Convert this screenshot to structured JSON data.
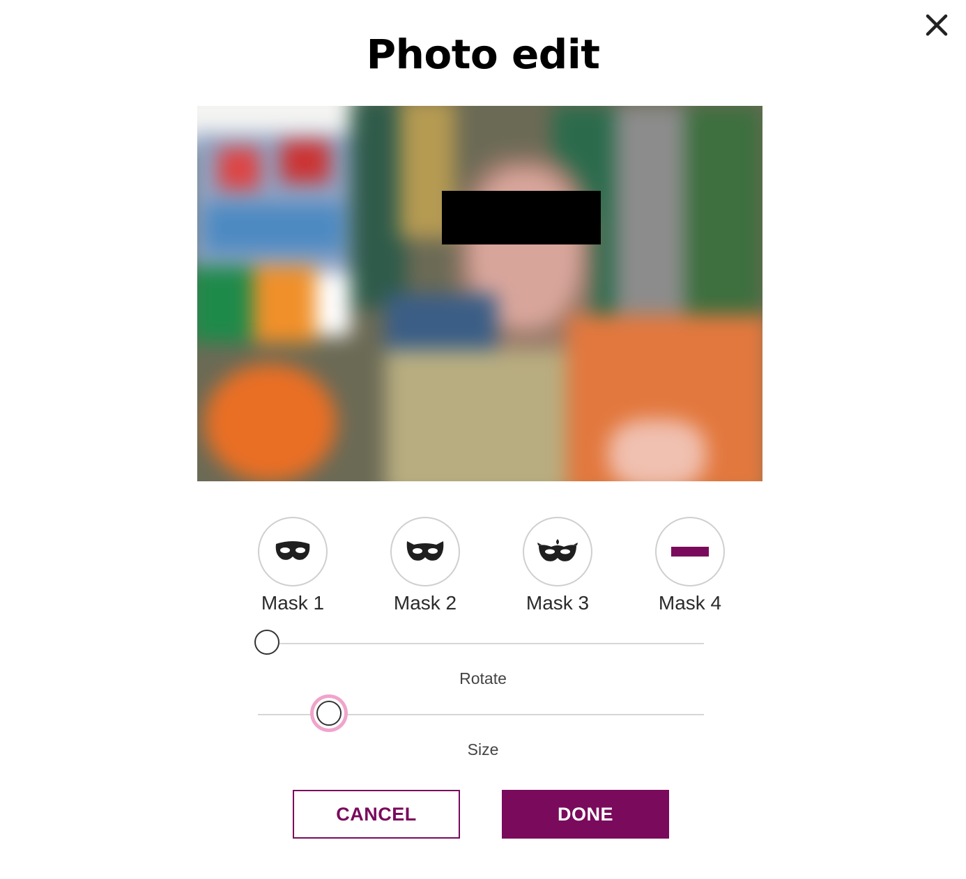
{
  "dialog": {
    "title": "Photo edit",
    "close_icon": "close-icon"
  },
  "photo": {
    "description_icon": "blurred-photo",
    "mask_color": "#000000"
  },
  "masks": [
    {
      "label": "Mask 1",
      "icon": "mask-plain-icon"
    },
    {
      "label": "Mask 2",
      "icon": "mask-cat-icon"
    },
    {
      "label": "Mask 3",
      "icon": "mask-ornate-icon"
    },
    {
      "label": "Mask 4",
      "icon": "bar-mask-icon"
    }
  ],
  "controls": {
    "rotate": {
      "label": "Rotate",
      "value_fraction": 0.02
    },
    "size": {
      "label": "Size",
      "value_fraction": 0.16
    }
  },
  "buttons": {
    "cancel": "CANCEL",
    "done": "DONE"
  },
  "colors": {
    "accent": "#7a0a5c",
    "slider_focus_ring": "#f0a4cb"
  }
}
